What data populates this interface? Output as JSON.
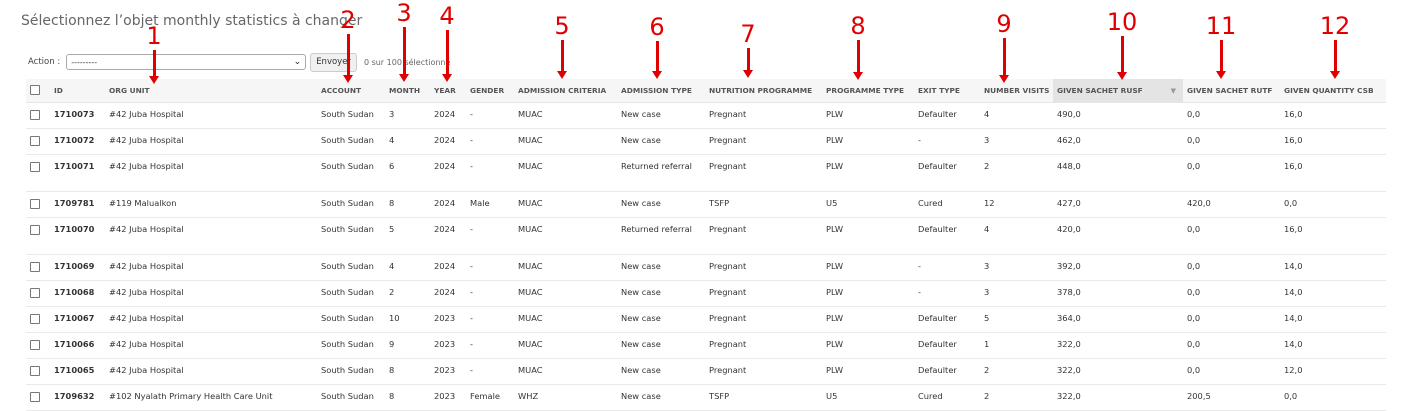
{
  "page": {
    "title": "Sélectionnez l’objet monthly statistics à changer"
  },
  "actions": {
    "label": "Action :",
    "selected": "---------",
    "go_label": "Envoyer",
    "counter": "0 sur 100 sélectionné"
  },
  "columns": [
    "ID",
    "ORG UNIT",
    "ACCOUNT",
    "MONTH",
    "YEAR",
    "GENDER",
    "ADMISSION CRITERIA",
    "ADMISSION TYPE",
    "NUTRITION PROGRAMME",
    "PROGRAMME TYPE",
    "EXIT TYPE",
    "NUMBER VISITS",
    "GIVEN SACHET RUSF",
    "GIVEN SACHET RUTF",
    "GIVEN QUANTITY CSB"
  ],
  "rows": [
    {
      "id": "1710073",
      "org_unit": "#42 Juba Hospital",
      "account": "South Sudan",
      "month": "3",
      "year": "2024",
      "gender": "-",
      "admission_criteria": "MUAC",
      "admission_type": "New case",
      "nutrition_programme": "Pregnant",
      "programme_type": "PLW",
      "exit_type": "Defaulter",
      "number_visits": "4",
      "given_sachet_rusf": "490,0",
      "given_sachet_rutf": "0,0",
      "given_quantity_csb": "16,0"
    },
    {
      "id": "1710072",
      "org_unit": "#42 Juba Hospital",
      "account": "South Sudan",
      "month": "4",
      "year": "2024",
      "gender": "-",
      "admission_criteria": "MUAC",
      "admission_type": "New case",
      "nutrition_programme": "Pregnant",
      "programme_type": "PLW",
      "exit_type": "-",
      "number_visits": "3",
      "given_sachet_rusf": "462,0",
      "given_sachet_rutf": "0,0",
      "given_quantity_csb": "16,0"
    },
    {
      "id": "1710071",
      "org_unit": "#42 Juba Hospital",
      "account": "South Sudan",
      "month": "6",
      "year": "2024",
      "gender": "-",
      "admission_criteria": "MUAC",
      "admission_type": "Returned referral",
      "nutrition_programme": "Pregnant",
      "programme_type": "PLW",
      "exit_type": "Defaulter",
      "number_visits": "2",
      "given_sachet_rusf": "448,0",
      "given_sachet_rutf": "0,0",
      "given_quantity_csb": "16,0"
    },
    {
      "id": "1709781",
      "org_unit": "#119 Malualkon",
      "account": "South Sudan",
      "month": "8",
      "year": "2024",
      "gender": "Male",
      "admission_criteria": "MUAC",
      "admission_type": "New case",
      "nutrition_programme": "TSFP",
      "programme_type": "U5",
      "exit_type": "Cured",
      "number_visits": "12",
      "given_sachet_rusf": "427,0",
      "given_sachet_rutf": "420,0",
      "given_quantity_csb": "0,0"
    },
    {
      "id": "1710070",
      "org_unit": "#42 Juba Hospital",
      "account": "South Sudan",
      "month": "5",
      "year": "2024",
      "gender": "-",
      "admission_criteria": "MUAC",
      "admission_type": "Returned referral",
      "nutrition_programme": "Pregnant",
      "programme_type": "PLW",
      "exit_type": "Defaulter",
      "number_visits": "4",
      "given_sachet_rusf": "420,0",
      "given_sachet_rutf": "0,0",
      "given_quantity_csb": "16,0"
    },
    {
      "id": "1710069",
      "org_unit": "#42 Juba Hospital",
      "account": "South Sudan",
      "month": "4",
      "year": "2024",
      "gender": "-",
      "admission_criteria": "MUAC",
      "admission_type": "New case",
      "nutrition_programme": "Pregnant",
      "programme_type": "PLW",
      "exit_type": "-",
      "number_visits": "3",
      "given_sachet_rusf": "392,0",
      "given_sachet_rutf": "0,0",
      "given_quantity_csb": "14,0"
    },
    {
      "id": "1710068",
      "org_unit": "#42 Juba Hospital",
      "account": "South Sudan",
      "month": "2",
      "year": "2024",
      "gender": "-",
      "admission_criteria": "MUAC",
      "admission_type": "New case",
      "nutrition_programme": "Pregnant",
      "programme_type": "PLW",
      "exit_type": "-",
      "number_visits": "3",
      "given_sachet_rusf": "378,0",
      "given_sachet_rutf": "0,0",
      "given_quantity_csb": "14,0"
    },
    {
      "id": "1710067",
      "org_unit": "#42 Juba Hospital",
      "account": "South Sudan",
      "month": "10",
      "year": "2023",
      "gender": "-",
      "admission_criteria": "MUAC",
      "admission_type": "New case",
      "nutrition_programme": "Pregnant",
      "programme_type": "PLW",
      "exit_type": "Defaulter",
      "number_visits": "5",
      "given_sachet_rusf": "364,0",
      "given_sachet_rutf": "0,0",
      "given_quantity_csb": "14,0"
    },
    {
      "id": "1710066",
      "org_unit": "#42 Juba Hospital",
      "account": "South Sudan",
      "month": "9",
      "year": "2023",
      "gender": "-",
      "admission_criteria": "MUAC",
      "admission_type": "New case",
      "nutrition_programme": "Pregnant",
      "programme_type": "PLW",
      "exit_type": "Defaulter",
      "number_visits": "1",
      "given_sachet_rusf": "322,0",
      "given_sachet_rutf": "0,0",
      "given_quantity_csb": "14,0"
    },
    {
      "id": "1710065",
      "org_unit": "#42 Juba Hospital",
      "account": "South Sudan",
      "month": "8",
      "year": "2023",
      "gender": "-",
      "admission_criteria": "MUAC",
      "admission_type": "New case",
      "nutrition_programme": "Pregnant",
      "programme_type": "PLW",
      "exit_type": "Defaulter",
      "number_visits": "2",
      "given_sachet_rusf": "322,0",
      "given_sachet_rutf": "0,0",
      "given_quantity_csb": "12,0"
    },
    {
      "id": "1709632",
      "org_unit": "#102 Nyalath Primary Health Care Unit",
      "account": "South Sudan",
      "month": "8",
      "year": "2023",
      "gender": "Female",
      "admission_criteria": "WHZ",
      "admission_type": "New case",
      "nutrition_programme": "TSFP",
      "programme_type": "U5",
      "exit_type": "Cured",
      "number_visits": "2",
      "given_sachet_rusf": "322,0",
      "given_sachet_rutf": "200,5",
      "given_quantity_csb": "0,0"
    }
  ],
  "annotations": {
    "color": "#e00000",
    "items": [
      {
        "label": "1"
      },
      {
        "label": "2"
      },
      {
        "label": "3"
      },
      {
        "label": "4"
      },
      {
        "label": "5"
      },
      {
        "label": "6"
      },
      {
        "label": "7"
      },
      {
        "label": "8"
      },
      {
        "label": "9"
      },
      {
        "label": "10"
      },
      {
        "label": "11"
      },
      {
        "label": "12"
      }
    ]
  },
  "icons": {
    "sort": "sort-descending-icon",
    "dropdown": "chevron-down-icon"
  }
}
